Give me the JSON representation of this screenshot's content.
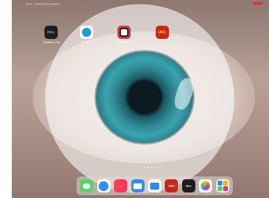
{
  "status_bar": {
    "left_text": "12:11 · Jueves 26 de marzo"
  },
  "home_apps": [
    {
      "name": "Hiru",
      "tile_text": "Hiru",
      "label": "Euskaraz Hiru"
    },
    {
      "name": "sync",
      "tile_text": "",
      "label": "Sincro"
    },
    {
      "name": "sim",
      "tile_text": "",
      "label": "Simulador"
    },
    {
      "name": "uno",
      "tile_text": "UNO",
      "label": ""
    }
  ],
  "page_dots": {
    "count": 6,
    "active_index": 1
  },
  "dock": [
    {
      "name": "messages",
      "tile_text": ""
    },
    {
      "name": "safari",
      "tile_text": ""
    },
    {
      "name": "music",
      "tile_text": "♫"
    },
    {
      "name": "mail",
      "tile_text": ""
    },
    {
      "name": "files",
      "tile_text": ""
    },
    {
      "name": "uno",
      "tile_text": "UNO"
    },
    {
      "name": "hiru",
      "tile_text": "Hiru"
    },
    {
      "name": "photos",
      "tile_text": ""
    },
    {
      "name": "app-library",
      "tile_text": ""
    }
  ],
  "colors": {
    "battery": "#d8343d",
    "iris": "#2f8a96",
    "dock_bg": "rgba(225,215,210,0.55)"
  }
}
